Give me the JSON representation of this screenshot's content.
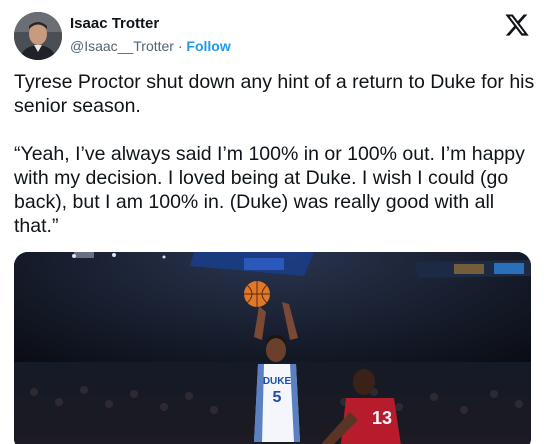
{
  "author": {
    "name": "Isaac Trotter",
    "handle": "@Isaac__Trotter",
    "separator": "·",
    "follow_label": "Follow"
  },
  "platform_icon": "x-logo-icon",
  "tweet": {
    "paragraph_1": "Tyrese Proctor shut down any hint of a return to Duke for his senior season.",
    "paragraph_2": "“Yeah, I’ve always said I’m 100% in or 100% out. I’m happy with my decision. I loved being at Duke. I wish I could (go back), but I am 100% in. (Duke) was really good with all that.”"
  },
  "media": {
    "jersey_front_text": "DUKE",
    "jersey_front_number": "5",
    "jersey_defender_number": "13",
    "colors": {
      "duke_blue": "#1a4ea8",
      "defender_red": "#b71c2c",
      "arena_dark": "#0a0d14",
      "ball_orange": "#e0782a"
    }
  }
}
